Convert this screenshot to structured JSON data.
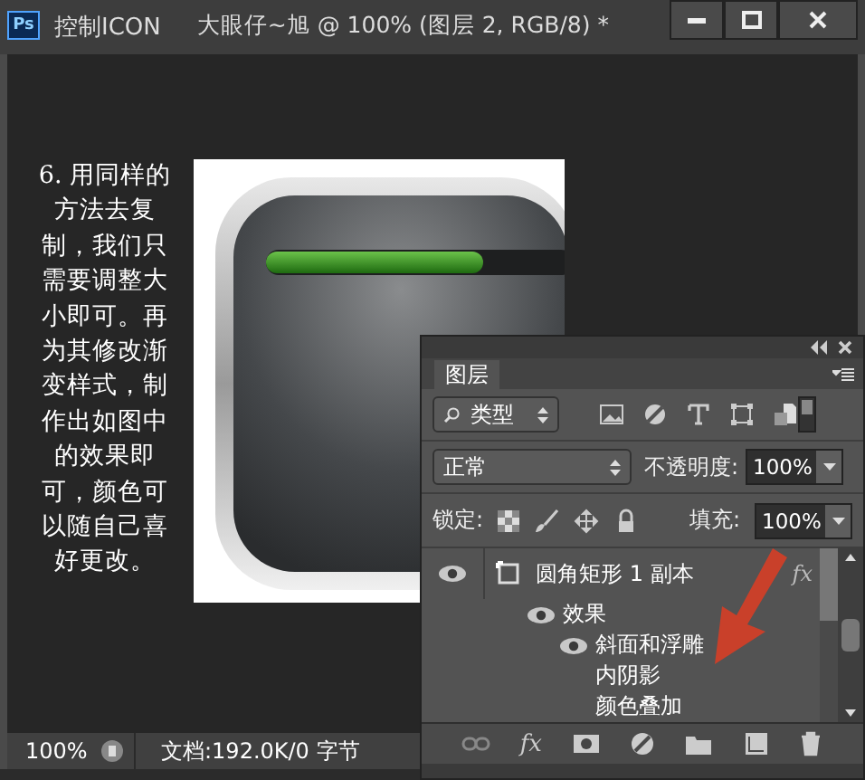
{
  "window": {
    "app_badge": "Ps",
    "title": "控制ICON",
    "document_title": "大眼仔~旭 @ 100% (图层 2, RGB/8) *"
  },
  "tutorial_text": "6. 用同样的方法去复制，我们只需要调整大小即可。再为其修改渐变样式，制作出如图中的效果即可，颜色可以随自己喜好更改。",
  "layers_panel": {
    "tabs": [
      {
        "label": "图层",
        "selected": true
      }
    ],
    "filter": {
      "value": "类型"
    },
    "blend_mode": {
      "value": "正常"
    },
    "opacity": {
      "label": "不透明度:",
      "value": "100%"
    },
    "lock": {
      "label": "锁定:"
    },
    "fill": {
      "label": "填充:",
      "value": "100%"
    },
    "layers": [
      {
        "name": "圆角矩形 1 副本",
        "visible": true,
        "kind": "shape",
        "badge": "fx",
        "children": [
          {
            "name": "效果",
            "visible": true,
            "children": [
              {
                "name": "斜面和浮雕",
                "visible": true
              },
              {
                "name": "内阴影",
                "visible": false
              },
              {
                "name": "颜色叠加",
                "visible": false
              }
            ]
          }
        ]
      }
    ],
    "toolbar_fx": "fx"
  },
  "status_bar": {
    "zoom": "100%",
    "doc_info": "文档:192.0K/0 字节"
  }
}
